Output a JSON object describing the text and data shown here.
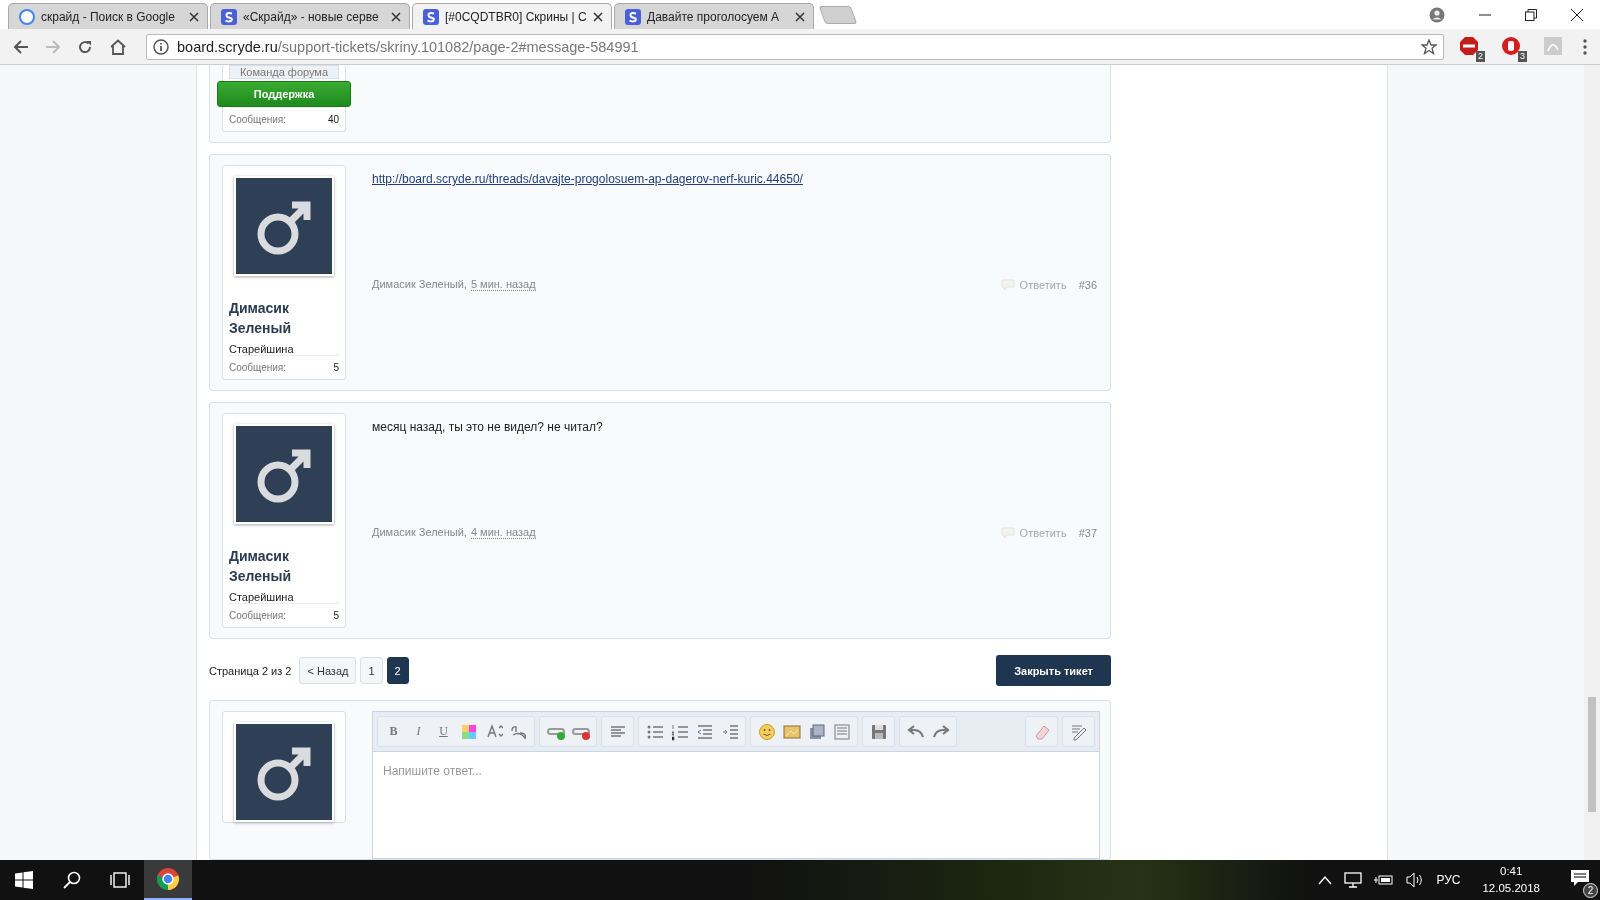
{
  "browser": {
    "tabs": [
      {
        "title": "скрайд - Поиск в Google",
        "selected": false
      },
      {
        "title": "«Скрайд» - новые серве",
        "selected": false
      },
      {
        "title": "[#0CQDTBR0] Скрины | С",
        "selected": true
      },
      {
        "title": "Давайте проголосуем А",
        "selected": false
      }
    ],
    "address": {
      "host": "board.scryde.ru",
      "path": "/support-tickets/skriny.101082/page-2#message-584991"
    },
    "extensions": [
      {
        "kind": "abp",
        "badge": "2"
      },
      {
        "kind": "stop",
        "badge": "3"
      },
      {
        "kind": "pdf"
      }
    ]
  },
  "posts": [
    {
      "kind": "partial",
      "user_title": "Команда форума",
      "banner": "Поддержка",
      "stats_label": "Сообщения:",
      "stats_value": "40"
    },
    {
      "kind": "full",
      "name": "Димасик Зеленый",
      "role": "Старейшина",
      "stats_label": "Сообщения:",
      "stats_value": "5",
      "link": "http://board.scryde.ru/threads/davajte-progolosuem-ap-dagerov-nerf-kuric.44650/",
      "author": "Димасик Зеленый,",
      "time": "5 мин. назад",
      "reply": "Ответить",
      "number": "#36"
    },
    {
      "kind": "full",
      "name": "Димасик Зеленый",
      "role": "Старейшина",
      "stats_label": "Сообщения:",
      "stats_value": "5",
      "text": "месяц назад, ты это не видел? не читал?",
      "author": "Димасик Зеленый,",
      "time": "4 мин. назад",
      "reply": "Ответить",
      "number": "#37"
    }
  ],
  "pagination": {
    "label": "Страница 2 из 2",
    "prev": "< Назад",
    "pages": [
      {
        "label": "1",
        "selected": false
      },
      {
        "label": "2",
        "selected": true
      }
    ],
    "close_button": "Закрыть тикет"
  },
  "editor": {
    "text_buttons": [
      "B",
      "I",
      "U"
    ],
    "placeholder": "Напишите ответ..."
  },
  "taskbar": {
    "language": "РУС",
    "time": "0:41",
    "date": "12.05.2018",
    "notifications": "2"
  }
}
